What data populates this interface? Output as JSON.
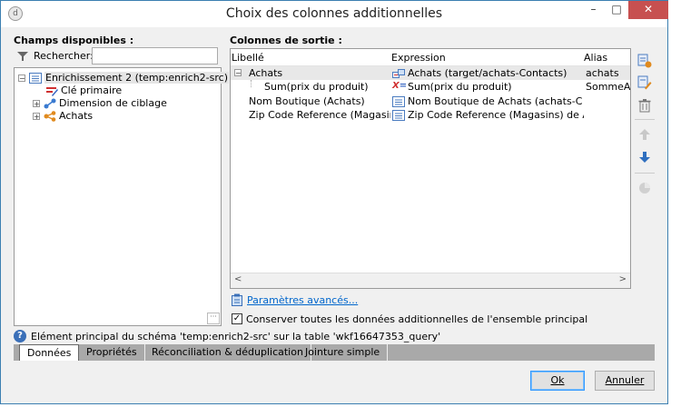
{
  "window": {
    "title": "Choix des colonnes additionnelles",
    "minimize_label": "–",
    "maximize_label": "□",
    "close_label": "✕",
    "app_icon_label": "d"
  },
  "left": {
    "heading": "Champs disponibles :",
    "search_label": "Rechercher:",
    "search_value": "",
    "tree": [
      {
        "label": "Enrichissement 2 (temp:enrich2-src)",
        "icon": "list-icon",
        "expander": "−"
      },
      {
        "label": "Clé primaire",
        "icon": "key-pencil-icon",
        "expander": ""
      },
      {
        "label": "Dimension de ciblage",
        "icon": "link-icon",
        "expander": "+"
      },
      {
        "label": "Achats",
        "icon": "share-link-icon",
        "expander": "+"
      }
    ],
    "corner_label": "···"
  },
  "right": {
    "heading": "Colonnes de sortie :",
    "columns": [
      "Libellé",
      "Expression",
      "Alias"
    ],
    "rows": [
      {
        "expander": "−",
        "label": "Achats",
        "expression": "Achats (target/achats-Contacts)",
        "alias": "achats",
        "expr_icon": "link-table-icon"
      },
      {
        "expander": "",
        "label": "Sum(prix du produit)",
        "expression": "Sum(prix du produit)",
        "alias": "SommeAc",
        "expr_icon": "function-icon"
      },
      {
        "expander": "",
        "label": "Nom Boutique (Achats)",
        "expression": "Nom Boutique de Achats (achats-Co...",
        "alias": "",
        "expr_icon": "list-icon"
      },
      {
        "expander": "",
        "label": "Zip Code Reference (Magasins)...",
        "expression": "Zip Code Reference (Magasins) de Ach...",
        "alias": "",
        "expr_icon": "list-icon"
      }
    ],
    "scroll_left": "<",
    "scroll_right": ">"
  },
  "advanced_link": "Paramètres avancés...",
  "keep_checkbox": {
    "label": "Conserver toutes les données additionnelles de l'ensemble principal",
    "checked": true
  },
  "info_text": "Elément principal du schéma 'temp:enrich2-src' sur la table 'wkf16647353_query'",
  "tabs": [
    "Données",
    "Propriétés",
    "Réconciliation & déduplication",
    "Jointure simple"
  ],
  "buttons": {
    "ok": "Ok",
    "cancel": "Annuler"
  },
  "colors": {
    "accent": "#3c7fb1",
    "close": "#c75050",
    "link": "#0066cc"
  }
}
